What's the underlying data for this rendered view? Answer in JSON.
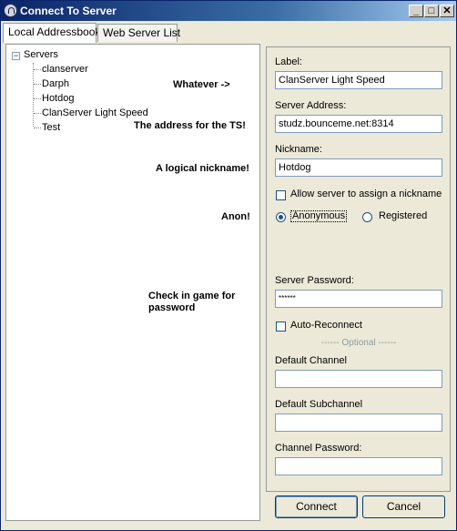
{
  "window": {
    "title": "Connect To Server",
    "min_glyph": "_",
    "max_glyph": "□",
    "close_glyph": "✕"
  },
  "tabs": [
    {
      "label": "Local Addressbook",
      "active": true
    },
    {
      "label": "Web Server List",
      "active": false
    }
  ],
  "tree": {
    "toggle": "−",
    "root": "Servers",
    "children": [
      "clanserver",
      "Darph",
      "Hotdog",
      "ClanServer Light Speed",
      "Test"
    ]
  },
  "annotations": {
    "label_note": "Whatever ->",
    "address_note": "The address for the TS!",
    "nickname_note": "A logical nickname!",
    "anon_note": "Anon!",
    "password_note_line1": "Check in game for",
    "password_note_line2": "password"
  },
  "form": {
    "label": {
      "caption": "Label:",
      "value": "ClanServer Light Speed"
    },
    "address": {
      "caption": "Server Address:",
      "value": "studz.bounceme.net:8314"
    },
    "nickname": {
      "caption": "Nickname:",
      "value": "Hotdog"
    },
    "allow_assign": {
      "caption": "Allow server to assign a nickname",
      "checked": false
    },
    "anonymous": {
      "caption": "Anonymous",
      "selected": true
    },
    "registered": {
      "caption": "Registered",
      "selected": false
    },
    "server_password": {
      "caption": "Server Password:",
      "value": "******"
    },
    "auto_reconnect": {
      "caption": "Auto-Reconnect",
      "checked": false
    },
    "optional_sep": "------ Optional ------",
    "default_channel": {
      "caption": "Default Channel",
      "value": ""
    },
    "default_subchannel": {
      "caption": "Default Subchannel",
      "value": ""
    },
    "channel_password": {
      "caption": "Channel Password:",
      "value": ""
    }
  },
  "buttons": {
    "connect": "Connect",
    "cancel": "Cancel"
  }
}
